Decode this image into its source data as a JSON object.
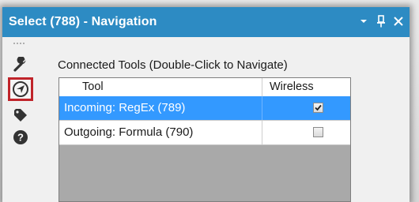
{
  "window": {
    "title": "Select (788) - Navigation",
    "buttons": [
      "dropdown-icon",
      "pin-icon",
      "close-icon"
    ]
  },
  "sidebar": {
    "icons": [
      {
        "name": "configuration-icon",
        "selected": false
      },
      {
        "name": "navigation-icon",
        "selected": true
      },
      {
        "name": "annotation-icon",
        "selected": false
      },
      {
        "name": "help-icon",
        "selected": false
      }
    ]
  },
  "navigation": {
    "label": "Connected Tools (Double-Click to Navigate)",
    "columns": [
      "Tool",
      "Wireless"
    ],
    "rows": [
      {
        "tool": "Incoming: RegEx (789)",
        "wireless": true,
        "selected": true
      },
      {
        "tool": "Outgoing: Formula (790)",
        "wireless": false,
        "selected": false
      }
    ]
  },
  "colors": {
    "titlebar": "#2d8bc3",
    "selection": "#3399ff",
    "highlight_border": "#c0242a"
  }
}
